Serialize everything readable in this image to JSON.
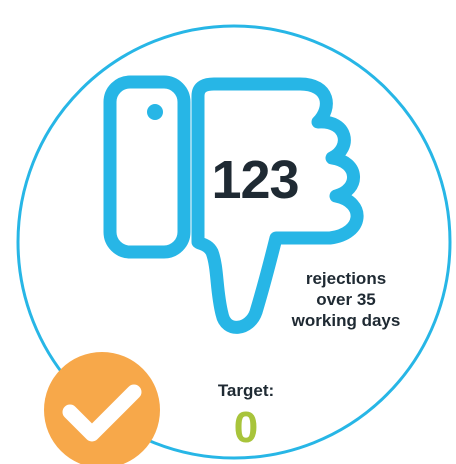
{
  "stat": {
    "count": "123",
    "description_lines": [
      "rejections",
      "over 35",
      "working days"
    ]
  },
  "target": {
    "label": "Target:",
    "value": "0"
  },
  "icons": {
    "main": "thumbs-down-icon",
    "badge": "check-icon"
  },
  "colors": {
    "icon_stroke": "#27b6e6",
    "ring": "#27b6e6",
    "text": "#1f2a33",
    "target_value": "#a8c43b",
    "badge_fill": "#f7a84a",
    "badge_check": "#ffffff"
  }
}
